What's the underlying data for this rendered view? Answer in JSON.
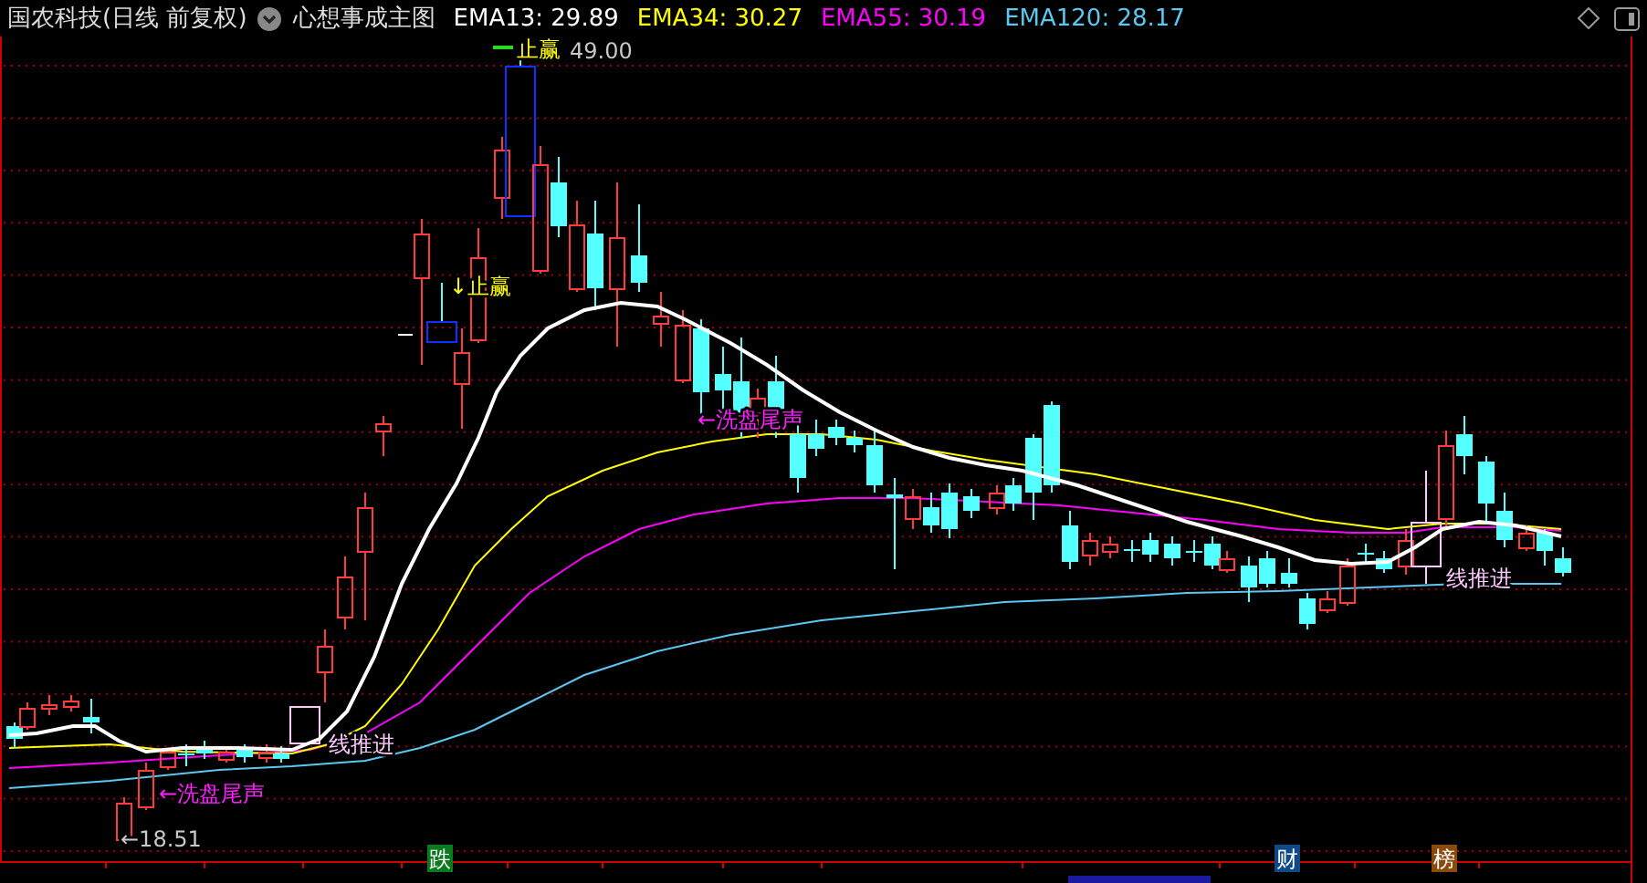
{
  "header": {
    "title": "国农科技(日线 前复权)",
    "indicator": "心想事成主图",
    "ema_labels": [
      {
        "text": "EMA13: 29.89",
        "color": "#ffffff"
      },
      {
        "text": "EMA34: 30.27",
        "color": "#ffff00"
      },
      {
        "text": "EMA55: 30.19",
        "color": "#ff00ff"
      },
      {
        "text": "EMA120: 28.17",
        "color": "#5ac8f0"
      }
    ]
  },
  "chart": {
    "annotations": [
      {
        "kind": "target",
        "text": "止赢"
      },
      {
        "kind": "price",
        "text": "49.00"
      },
      {
        "kind": "target",
        "text": "↓止赢"
      },
      {
        "kind": "wash",
        "text": "←洗盘尾声"
      },
      {
        "kind": "push",
        "text": "线推进"
      },
      {
        "kind": "push",
        "text": "线推进"
      },
      {
        "kind": "wash",
        "text": "←洗盘尾声"
      },
      {
        "kind": "price",
        "text": "←18.51"
      }
    ],
    "badges": [
      {
        "text": "跌",
        "color": "#0b7a1f"
      },
      {
        "text": "财",
        "color": "#0f4a86"
      },
      {
        "text": "榜",
        "color": "#8a4a0c"
      }
    ]
  }
}
